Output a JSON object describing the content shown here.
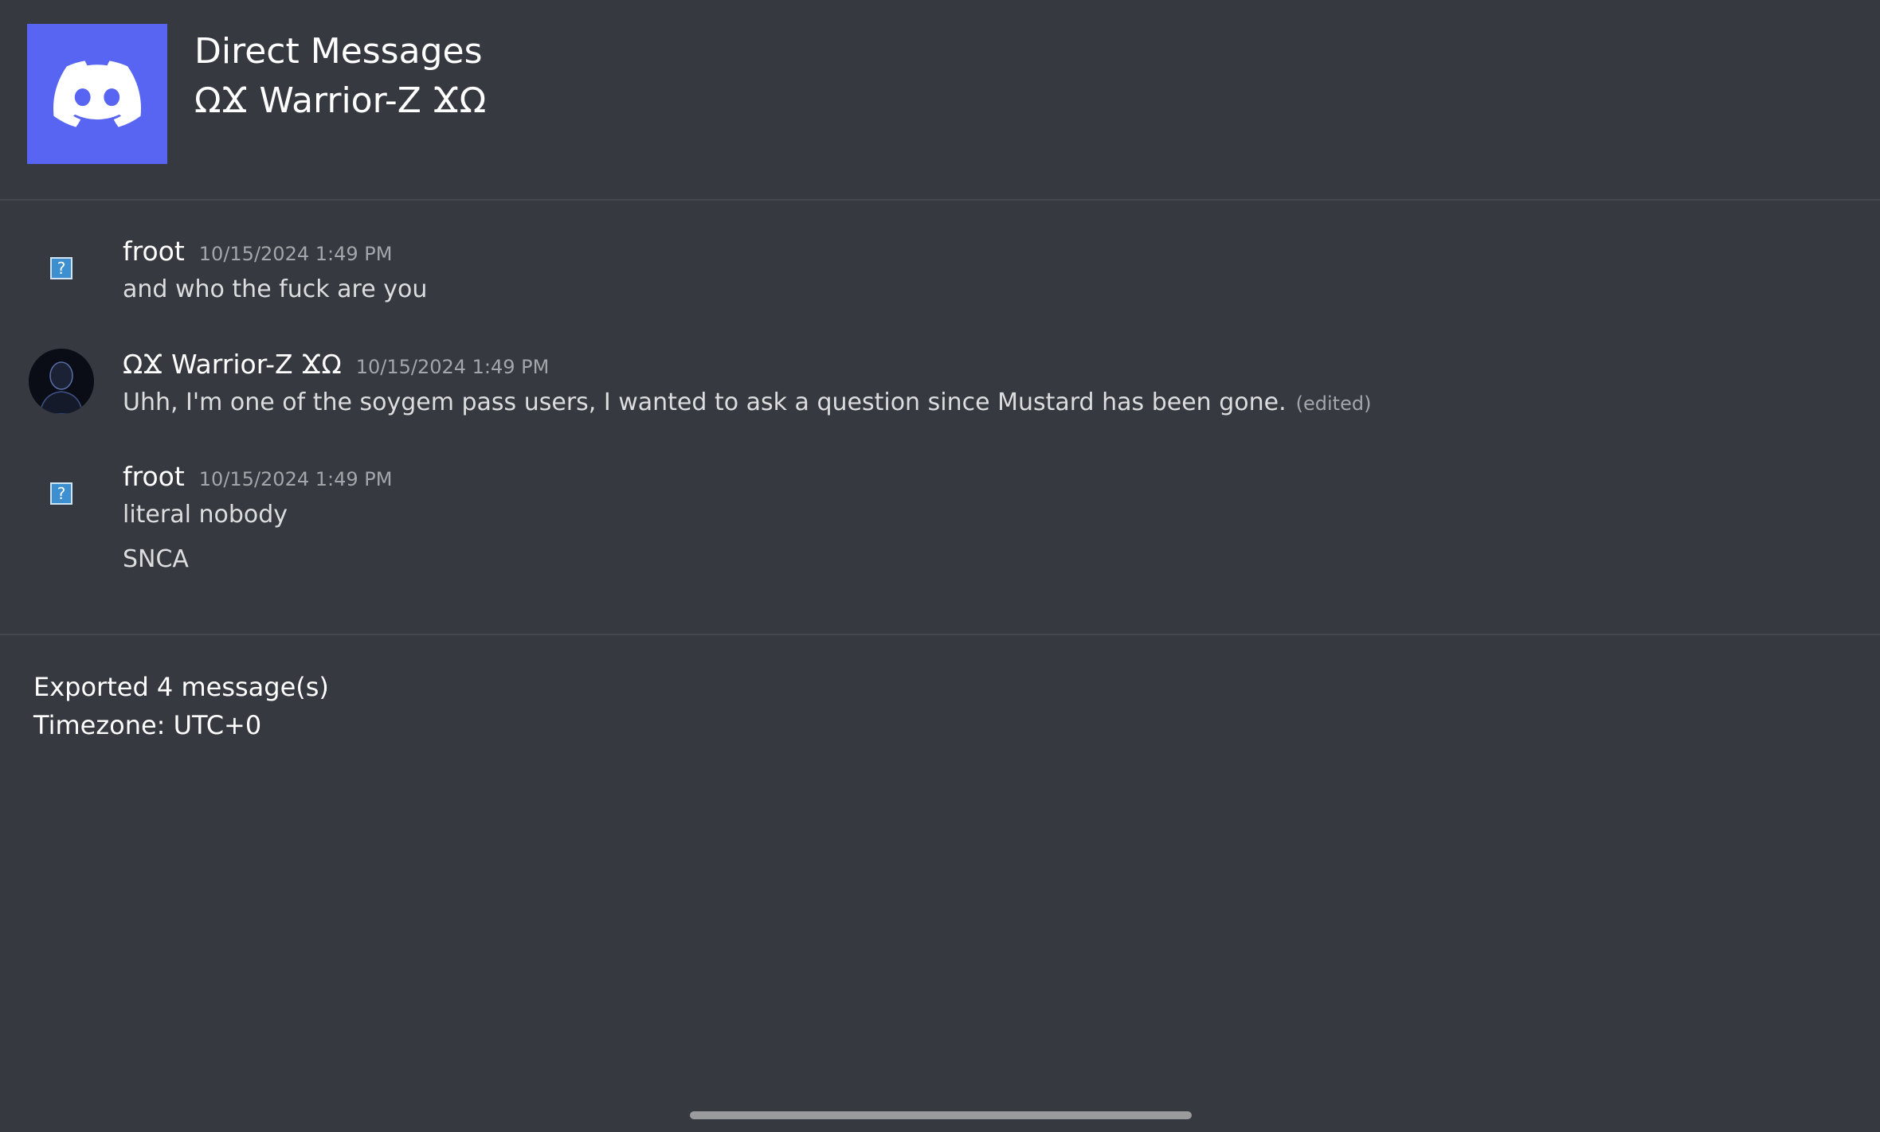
{
  "preamble": {
    "icon": "discord-logo-icon",
    "icon_color": "#5865f2",
    "category": "Direct Messages",
    "channel": "ΩϪ Warrior-Z ϪΩ"
  },
  "messages": [
    {
      "author": "froot",
      "timestamp": "10/15/2024 1:49 PM",
      "avatar": "broken-image-icon",
      "lines": [
        "and who the fuck are you"
      ]
    },
    {
      "author": "ΩϪ Warrior-Z ϪΩ",
      "timestamp": "10/15/2024 1:49 PM",
      "avatar": "dark-portrait-avatar",
      "lines": [
        "Uhh, I'm one of the soygem pass users, I wanted to ask a question since Mustard has been gone."
      ],
      "edited_label": "(edited)"
    },
    {
      "author": "froot",
      "timestamp": "10/15/2024 1:49 PM",
      "avatar": "broken-image-icon",
      "lines": [
        "literal nobody",
        "SNCA"
      ]
    }
  ],
  "postamble": {
    "exported": "Exported 4 message(s)",
    "timezone": "Timezone: UTC+0"
  },
  "colors": {
    "background": "#36393f",
    "divider": "#44474d",
    "text": "#dcddde",
    "muted": "#a3a6aa"
  }
}
